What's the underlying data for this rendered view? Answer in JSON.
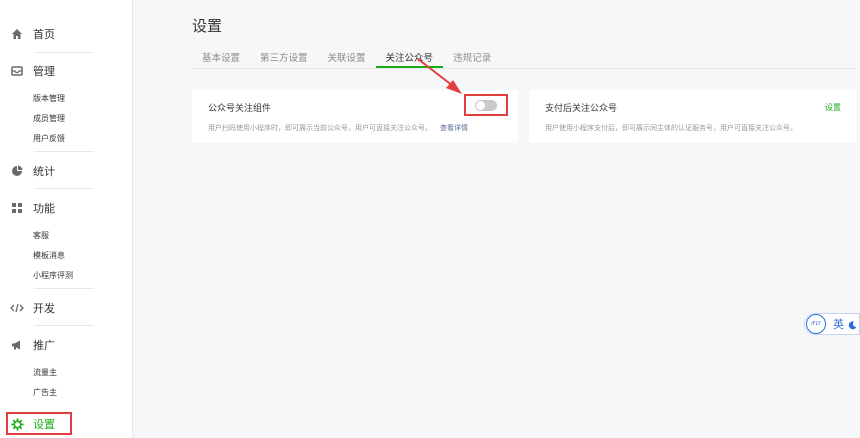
{
  "sidebar": {
    "home": "首页",
    "manage": {
      "label": "管理",
      "items": [
        "版本管理",
        "成员管理",
        "用户反馈"
      ]
    },
    "stats": "统计",
    "features": {
      "label": "功能",
      "items": [
        "客服",
        "模板消息",
        "小程序评测"
      ]
    },
    "develop": "开发",
    "promote": {
      "label": "推广",
      "items": [
        "流量主",
        "广告主"
      ]
    },
    "settings": "设置"
  },
  "page": {
    "title": "设置",
    "tabs": [
      "基本设置",
      "第三方设置",
      "关联设置",
      "关注公众号",
      "违规记录"
    ],
    "active_tab": "关注公众号"
  },
  "cards": [
    {
      "title": "公众号关注组件",
      "desc": "用户扫码使用小程序时，即可展示当前公众号，用户可直接关注公众号。",
      "link": "查看详情",
      "toggle_on": false
    },
    {
      "title": "支付后关注公众号",
      "desc": "用户使用小程序支付后，即可展示同主体的认证服务号，用户可直接关注公众号。",
      "action": "设置"
    }
  ],
  "ifly": {
    "logo": "iFLY",
    "lang": "英"
  },
  "colors": {
    "accent": "#1aad19",
    "highlight": "#e43d3d",
    "link": "#576b95"
  }
}
